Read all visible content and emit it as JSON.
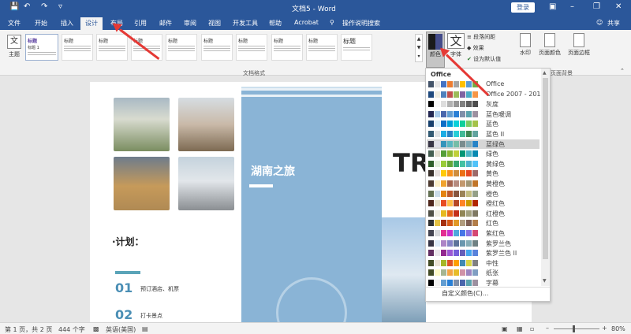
{
  "window": {
    "title": "文档5 - Word",
    "login": "登录"
  },
  "quick_access": {
    "save_icon": "save-icon",
    "undo_icon": "undo-icon",
    "redo_icon": "redo-icon",
    "customize_icon": "customize-icon"
  },
  "menu": {
    "tabs": [
      "文件",
      "开始",
      "插入",
      "设计",
      "布局",
      "引用",
      "邮件",
      "审阅",
      "视图",
      "开发工具",
      "帮助",
      "Acrobat"
    ],
    "search": "操作说明搜索",
    "share": "共享",
    "active_tab": "设计"
  },
  "ribbon": {
    "theme_label": "主题",
    "theme_glyph": "文",
    "style_titles": [
      "标题",
      "标题",
      "标题",
      "标题",
      "标题",
      "标题",
      "标题",
      "标题",
      "标题",
      "标题"
    ],
    "style_first_sub": "标题 1",
    "colors_label": "颜色",
    "fonts_label": "字体",
    "fonts_glyph": "文",
    "paragraph_spacing": "段落间距",
    "effects": "效果",
    "set_default": "设为默认值",
    "watermark": "水印",
    "page_color": "页面颜色",
    "page_borders": "页面边框",
    "group_doc_format": "文档格式",
    "group_background": "页面背景"
  },
  "document": {
    "hunan_title": "湖南之旅",
    "plan_title": "·计划：",
    "item1_num": "01",
    "item1_text": "预订酒店、机票",
    "item2_num": "02",
    "item2_text": "打卡景点",
    "big_text": "TR"
  },
  "color_menu": {
    "header": "Office",
    "items": [
      {
        "label": "Office",
        "colors": [
          "#44546a",
          "#e7e6e6",
          "#4472c4",
          "#ed7d31",
          "#a5a5a5",
          "#ffc000",
          "#5b9bd5",
          "#70ad47"
        ]
      },
      {
        "label": "Office 2007 - 2010",
        "colors": [
          "#1f497d",
          "#eeece1",
          "#4f81bd",
          "#c0504d",
          "#9bbb59",
          "#8064a2",
          "#4bacc6",
          "#f79646"
        ]
      },
      {
        "label": "灰度",
        "colors": [
          "#000000",
          "#f8f8f8",
          "#dddddd",
          "#b2b2b2",
          "#969696",
          "#808080",
          "#5f5f5f",
          "#4d4d4d"
        ]
      },
      {
        "label": "蓝色暖调",
        "colors": [
          "#242852",
          "#acccea",
          "#4a66ac",
          "#629dd1",
          "#297fd5",
          "#7f8fa9",
          "#5aa2ae",
          "#9d90a0"
        ]
      },
      {
        "label": "蓝色",
        "colors": [
          "#17406d",
          "#dbeff9",
          "#0f6fc6",
          "#009dd9",
          "#0bd0d9",
          "#10cf9b",
          "#7cca62",
          "#a5c249"
        ]
      },
      {
        "label": "蓝色 II",
        "colors": [
          "#335b74",
          "#dfe3e5",
          "#1cade4",
          "#2683c6",
          "#27ced7",
          "#42ba97",
          "#3e8853",
          "#62a39f"
        ]
      },
      {
        "label": "蓝绿色",
        "colors": [
          "#373545",
          "#dedee6",
          "#3494ba",
          "#58b6c0",
          "#75bda7",
          "#7a8c8e",
          "#84acb6",
          "#2683c6"
        ]
      },
      {
        "label": "绿色",
        "colors": [
          "#455f51",
          "#e3ded1",
          "#549e39",
          "#8ab833",
          "#c0cf3a",
          "#029676",
          "#4ab5c4",
          "#0989b1"
        ]
      },
      {
        "label": "黄绿色",
        "colors": [
          "#2f5f2a",
          "#e2efda",
          "#99cb38",
          "#63a537",
          "#37a76f",
          "#44c1a3",
          "#4eb3cf",
          "#51c3f9"
        ]
      },
      {
        "label": "黄色",
        "colors": [
          "#39302a",
          "#e5dedb",
          "#ffca08",
          "#f8931d",
          "#ce8d3e",
          "#ec7016",
          "#e64823",
          "#9c6a6a"
        ]
      },
      {
        "label": "黄橙色",
        "colors": [
          "#4e3b30",
          "#fbeec9",
          "#f0a22e",
          "#a5644e",
          "#b58b80",
          "#c3986d",
          "#a19574",
          "#c17529"
        ]
      },
      {
        "label": "橙色",
        "colors": [
          "#637052",
          "#ccddea",
          "#e48312",
          "#bd582c",
          "#865640",
          "#9b8357",
          "#c2bc80",
          "#94a088"
        ]
      },
      {
        "label": "橙红色",
        "colors": [
          "#4f271c",
          "#e7dec9",
          "#e84c22",
          "#ffbd47",
          "#b64926",
          "#ff8427",
          "#cc9900",
          "#b22600"
        ]
      },
      {
        "label": "红橙色",
        "colors": [
          "#505046",
          "#eeece1",
          "#e6b91e",
          "#e76618",
          "#c42f1a",
          "#918655",
          "#a2a07e",
          "#7e7862"
        ]
      },
      {
        "label": "红色",
        "colors": [
          "#323232",
          "#e5c243",
          "#a5300f",
          "#d55816",
          "#e19825",
          "#b19c7d",
          "#7f5f52",
          "#b27d49"
        ]
      },
      {
        "label": "紫红色",
        "colors": [
          "#454551",
          "#d8d9dc",
          "#e32d91",
          "#c830cc",
          "#4ea6dc",
          "#4775e7",
          "#8971e1",
          "#d54773"
        ]
      },
      {
        "label": "紫罗兰色",
        "colors": [
          "#373545",
          "#dceaf7",
          "#ad84c6",
          "#8784c7",
          "#5d739a",
          "#6997af",
          "#84acb6",
          "#6f8183"
        ]
      },
      {
        "label": "紫罗兰色 II",
        "colors": [
          "#632e62",
          "#eae5eb",
          "#92278f",
          "#9b57d3",
          "#755dd9",
          "#665eb8",
          "#45a5ed",
          "#5982db"
        ]
      },
      {
        "label": "中性",
        "colors": [
          "#444d26",
          "#ebe3d4",
          "#a6b727",
          "#df5327",
          "#fe9e00",
          "#418ab3",
          "#d7d447",
          "#818183"
        ]
      },
      {
        "label": "纸张",
        "colors": [
          "#444d26",
          "#fefac9",
          "#a5b592",
          "#f3a447",
          "#e7bc29",
          "#d092a7",
          "#9c85c0",
          "#809ec2"
        ]
      },
      {
        "label": "字幕",
        "colors": [
          "#000000",
          "#f0f0f0",
          "#629dd1",
          "#297fd5",
          "#7f8fa9",
          "#4a66ac",
          "#5aa2ae",
          "#9d90a0"
        ]
      }
    ],
    "selected_label": "蓝绿色",
    "customize": "自定义颜色(C)..."
  },
  "status": {
    "page": "第 1 页，共 2 页",
    "words": "444 个字",
    "language": "英语(美国)",
    "zoom": "80%"
  }
}
